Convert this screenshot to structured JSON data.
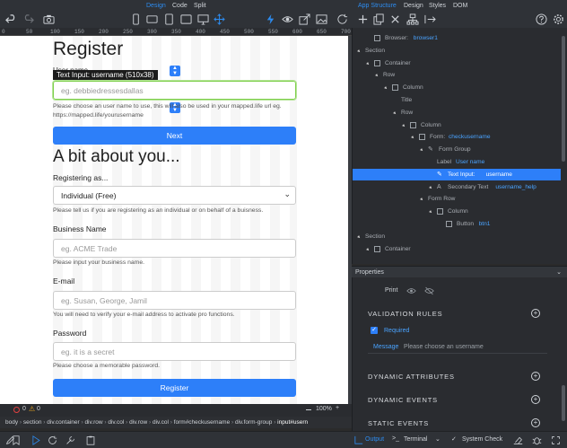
{
  "toolbar": {
    "modes": [
      "Design",
      "Code",
      "Split"
    ],
    "active_mode": "Design",
    "panel_tabs": [
      "App Structure",
      "Design",
      "Styles",
      "DOM"
    ],
    "active_panel_tab": "App Structure"
  },
  "ruler": {
    "ticks": [
      "0",
      "50",
      "100",
      "150",
      "200",
      "250",
      "300",
      "350",
      "400",
      "450",
      "500",
      "550",
      "600",
      "650",
      "700"
    ]
  },
  "page": {
    "title": "Register",
    "username_label": "User name",
    "selection_tooltip": "Text Input: username (510x38)",
    "username_placeholder": "eg. debbiedressesdallas",
    "username_help": "Please choose an user name to use, this will also be used in your mapped.life url eg. https://mapped.life/yourusername",
    "next_button": "Next",
    "about_heading": "A bit about you...",
    "registering_label": "Registering as...",
    "registering_value": "Individual (Free)",
    "registering_help": "Please tell us if you are registering as an individual or on behalf of a buisness.",
    "business_label": "Business Name",
    "business_placeholder": "eg. ACME Trade",
    "business_help": "Please input your business name.",
    "email_label": "E-mail",
    "email_placeholder": "eg. Susan, George, Jamil",
    "email_help": "You will need to verify your e-mail address to activate pro functions.",
    "password_label": "Password",
    "password_placeholder": "eg. it is a secret",
    "password_help": "Please choose a memorable password.",
    "register_button": "Register"
  },
  "status": {
    "errors": "0",
    "warnings": "0",
    "zoom": "100%"
  },
  "breadcrumb": [
    "body",
    "section",
    "div.container",
    "div.row",
    "div.col",
    "div.row",
    "div.col",
    "form#checkusername",
    "div.form-group",
    "input#usern"
  ],
  "tree": [
    {
      "label": "Browser:",
      "name": "browser1"
    },
    {
      "label": "Section",
      "name": ""
    },
    {
      "label": "Container",
      "name": ""
    },
    {
      "label": "Row",
      "name": ""
    },
    {
      "label": "Column",
      "name": ""
    },
    {
      "label": "Title",
      "name": ""
    },
    {
      "label": "Row",
      "name": ""
    },
    {
      "label": "Column",
      "name": ""
    },
    {
      "label": "Form:",
      "name": "checkusername"
    },
    {
      "label": "Form Group",
      "name": ""
    },
    {
      "label": "Label",
      "name": "User name"
    },
    {
      "label": "Text Input:",
      "name": "username"
    },
    {
      "label": "Secondary Text",
      "name": "username_help"
    },
    {
      "label": "Form Row",
      "name": ""
    },
    {
      "label": "Column",
      "name": ""
    },
    {
      "label": "Button",
      "name": "btn1"
    },
    {
      "label": "Section",
      "name": ""
    },
    {
      "label": "Container",
      "name": ""
    }
  ],
  "properties": {
    "header": "Properties",
    "print_label": "Print",
    "validation_rules": "VALIDATION RULES",
    "required_label": "Required",
    "message_label": "Message",
    "message_placeholder": "Please choose an username",
    "dynamic_attributes": "DYNAMIC ATTRIBUTES",
    "dynamic_events": "DYNAMIC EVENTS",
    "static_events": "STATIC EVENTS"
  },
  "bottom": {
    "output": "Output",
    "terminal": "Terminal",
    "system_check": "System Check"
  },
  "colors": {
    "accent": "#2d7ff9",
    "panel_bg": "#2a2c30",
    "toolbar_bg": "#2f3237"
  }
}
